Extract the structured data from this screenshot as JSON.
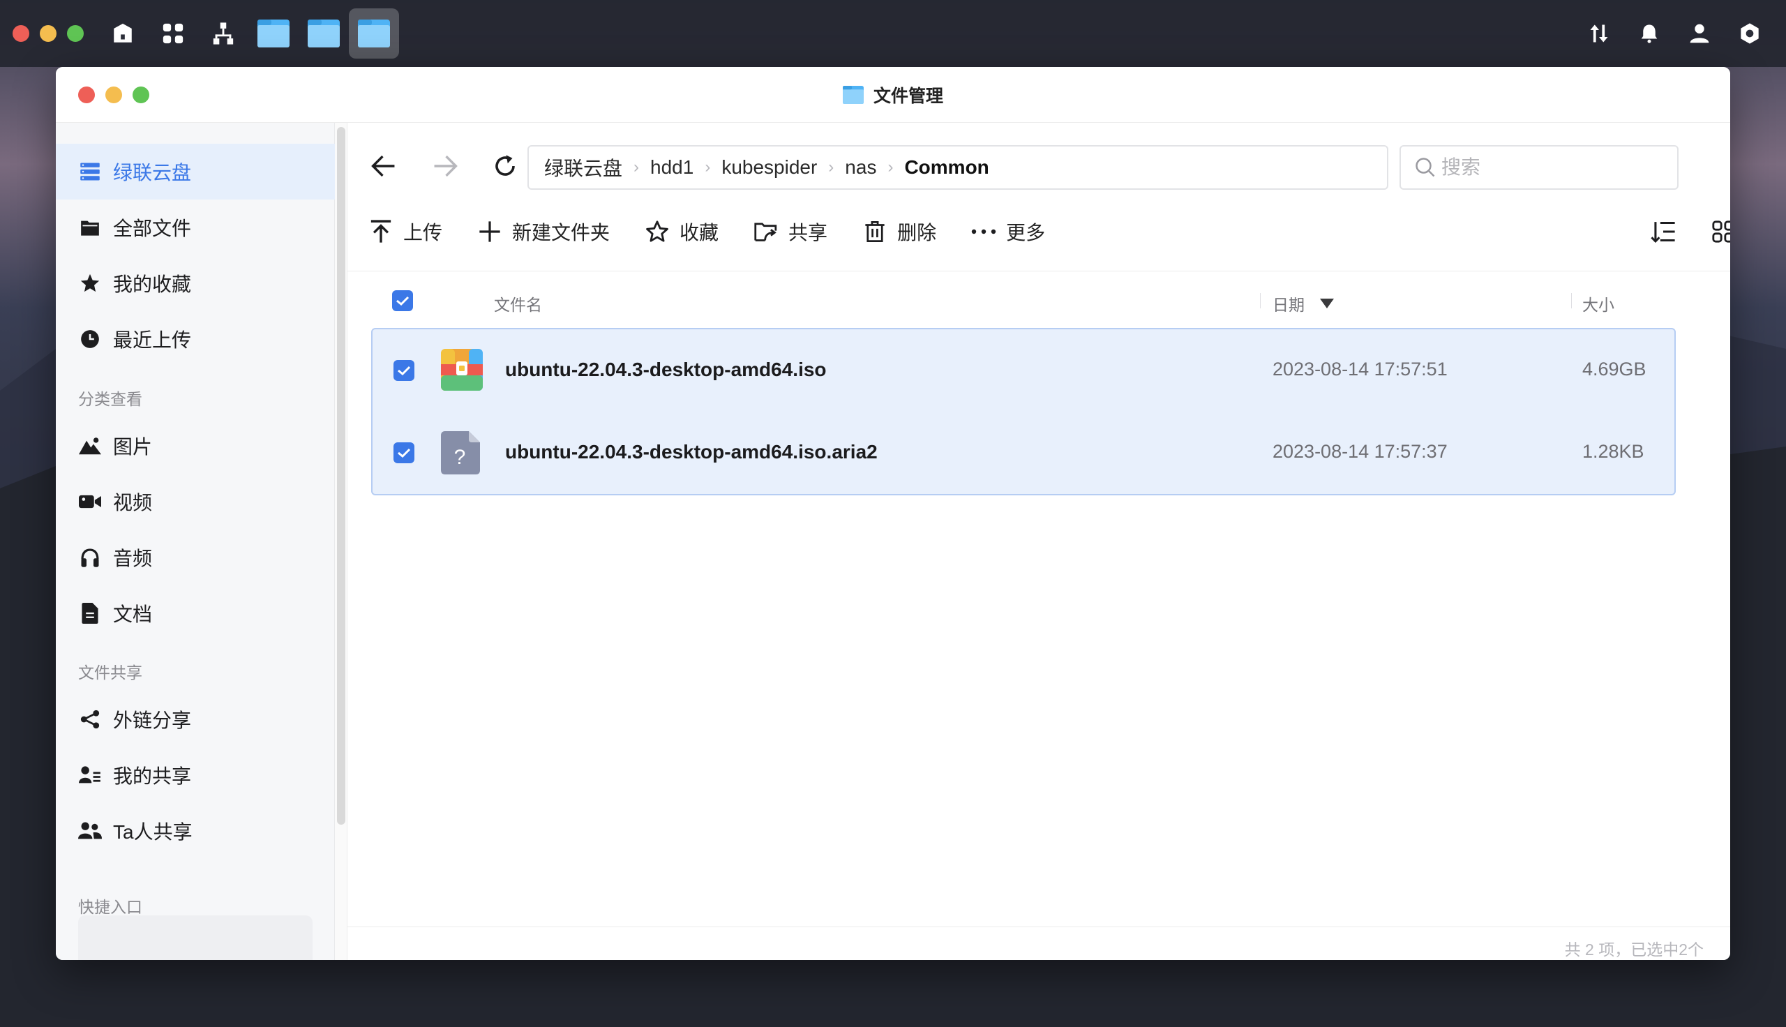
{
  "desktop": {
    "dock_icons": [
      "home-icon",
      "apps-grid-icon",
      "network-icon",
      "folder-icon",
      "folder-icon",
      "folder-icon"
    ],
    "right_icons": [
      "transfer-icon",
      "bell-icon",
      "user-icon",
      "settings-hex-icon"
    ]
  },
  "window": {
    "title": "文件管理",
    "title_icon": "folder-icon"
  },
  "sidebar": {
    "main_items": [
      {
        "label": "绿联云盘",
        "icon": "storage-icon",
        "active": true
      },
      {
        "label": "全部文件",
        "icon": "folder-icon"
      },
      {
        "label": "我的收藏",
        "icon": "star-icon"
      },
      {
        "label": "最近上传",
        "icon": "clock-icon"
      }
    ],
    "section_category": "分类查看",
    "category_items": [
      {
        "label": "图片",
        "icon": "image-icon"
      },
      {
        "label": "视频",
        "icon": "video-icon"
      },
      {
        "label": "音频",
        "icon": "headphones-icon"
      },
      {
        "label": "文档",
        "icon": "document-icon"
      }
    ],
    "section_share": "文件共享",
    "share_items": [
      {
        "label": "外链分享",
        "icon": "share-icon"
      },
      {
        "label": "我的共享",
        "icon": "user-list-icon"
      },
      {
        "label": "Ta人共享",
        "icon": "users-icon"
      }
    ],
    "section_quick": "快捷入口"
  },
  "breadcrumb": {
    "items": [
      "绿联云盘",
      "hdd1",
      "kubespider",
      "nas",
      "Common"
    ]
  },
  "search": {
    "placeholder": "搜索"
  },
  "toolbar": {
    "upload": "上传",
    "new_folder": "新建文件夹",
    "favorite": "收藏",
    "share": "共享",
    "delete": "删除",
    "more": "更多"
  },
  "columns": {
    "name": "文件名",
    "date": "日期",
    "size": "大小"
  },
  "files": [
    {
      "name": "ubuntu-22.04.3-desktop-amd64.iso",
      "date": "2023-08-14 17:57:51",
      "size": "4.69GB",
      "icon": "archive-icon",
      "selected": true
    },
    {
      "name": "ubuntu-22.04.3-desktop-amd64.iso.aria2",
      "date": "2023-08-14 17:57:37",
      "size": "1.28KB",
      "icon": "unknown-file-icon",
      "selected": true
    }
  ],
  "status": "共 2 项，已选中2个",
  "colors": {
    "accent": "#3b78e7",
    "selected_row_bg": "#e8f0fc"
  }
}
